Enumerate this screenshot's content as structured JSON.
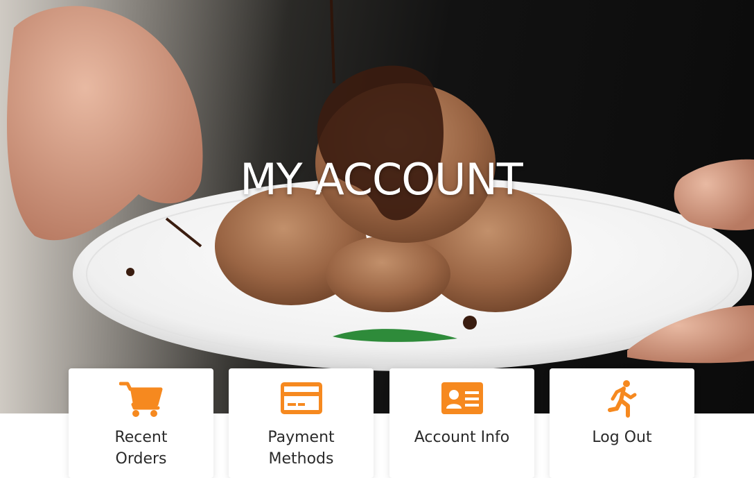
{
  "hero": {
    "title": "MY ACCOUNT"
  },
  "accent_color": "#F6891F",
  "cards": [
    {
      "label": "Recent Orders",
      "icon": "shopping-cart-icon"
    },
    {
      "label": "Payment Methods",
      "icon": "credit-card-icon"
    },
    {
      "label": "Account Info",
      "icon": "id-card-icon"
    },
    {
      "label": "Log Out",
      "icon": "running-person-icon"
    }
  ]
}
